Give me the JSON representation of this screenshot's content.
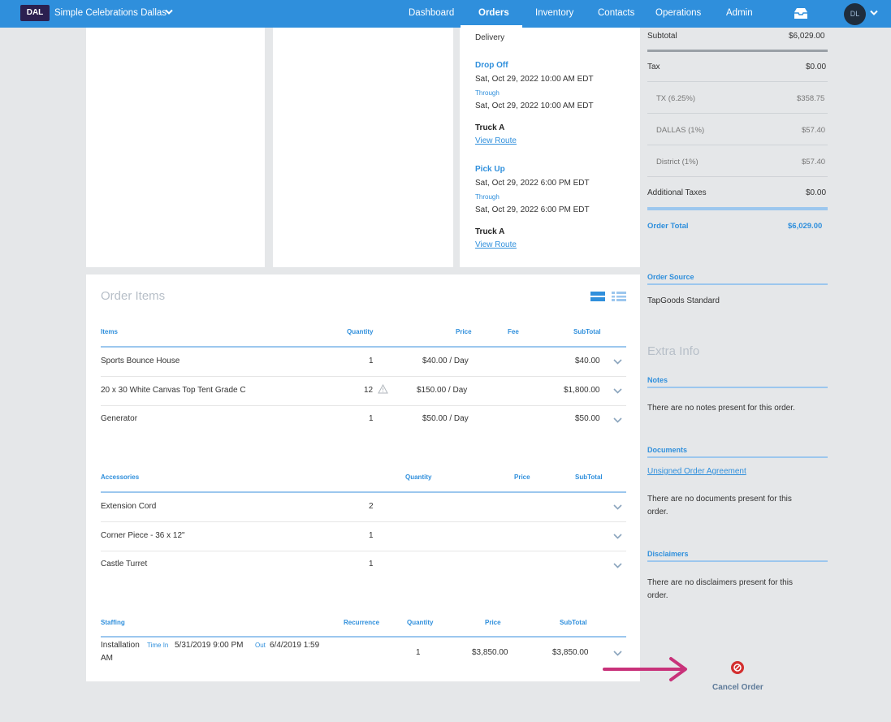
{
  "header": {
    "badge": "DAL",
    "company": "Simple Celebrations Dallas",
    "nav": [
      "Dashboard",
      "Orders",
      "Inventory",
      "Contacts",
      "Operations",
      "Admin"
    ],
    "active_nav": "Orders",
    "avatar_initials": "DL"
  },
  "delivery": {
    "heading": "Delivery",
    "drop_off_label": "Drop Off",
    "drop_off_start": "Sat, Oct 29, 2022 10:00 AM EDT",
    "through_1": "Through",
    "drop_off_end": "Sat, Oct 29, 2022 10:00 AM EDT",
    "truck_1": "Truck A",
    "view_route_1": "View Route",
    "pick_up_label": "Pick Up",
    "pick_up_start": "Sat, Oct 29, 2022 6:00 PM EDT",
    "through_2": "Through",
    "pick_up_end": "Sat, Oct 29, 2022 6:00 PM EDT",
    "truck_2": "Truck A",
    "view_route_2": "View Route"
  },
  "order_items": {
    "title": "Order Items",
    "items_headers": {
      "items": "Items",
      "quantity": "Quantity",
      "price": "Price",
      "fee": "Fee",
      "subtotal": "SubTotal"
    },
    "items": [
      {
        "name": "Sports Bounce House",
        "qty": "1",
        "price": "$40.00 / Day",
        "subtotal": "$40.00"
      },
      {
        "name": "20 x 30 White Canvas Top Tent Grade C",
        "qty": "12",
        "price": "$150.00 / Day",
        "subtotal": "$1,800.00"
      },
      {
        "name": "Generator",
        "qty": "1",
        "price": "$50.00 / Day",
        "subtotal": "$50.00"
      }
    ],
    "accessories_headers": {
      "accessories": "Accessories",
      "quantity": "Quantity",
      "price": "Price",
      "subtotal": "SubTotal"
    },
    "accessories": [
      {
        "name": "Extension Cord",
        "qty": "2"
      },
      {
        "name": "Corner Piece - 36 x 12\"",
        "qty": "1"
      },
      {
        "name": "Castle Turret",
        "qty": "1"
      }
    ],
    "staffing_headers": {
      "staffing": "Staffing",
      "recurrence": "Recurrence",
      "quantity": "Quantity",
      "price": "Price",
      "subtotal": "SubTotal"
    },
    "staffing": {
      "name": "Installation",
      "time_in_label": "Time In",
      "time_in": "5/31/2019 9:00 PM",
      "out_label": "Out",
      "out": "6/4/2019 1:59",
      "out_suffix": "AM",
      "qty": "1",
      "price": "$3,850.00",
      "subtotal": "$3,850.00"
    }
  },
  "summary": {
    "subtotal_label": "Subtotal",
    "subtotal": "$6,029.00",
    "tax_label": "Tax",
    "tax": "$0.00",
    "tx_label": "TX (6.25%)",
    "tx": "$358.75",
    "dallas_label": "DALLAS (1%)",
    "dallas": "$57.40",
    "district_label": "District (1%)",
    "district": "$57.40",
    "additional_label": "Additional Taxes",
    "additional": "$0.00",
    "total_label": "Order Total",
    "total": "$6,029.00",
    "source_label": "Order Source",
    "source": "TapGoods Standard"
  },
  "extra": {
    "title": "Extra Info",
    "notes_label": "Notes",
    "notes_text": "There are no notes present for this order.",
    "documents_label": "Documents",
    "documents_link": "Unsigned Order Agreement",
    "documents_text_1": "There are no documents present for this",
    "documents_text_2": "order.",
    "disclaimers_label": "Disclaimers",
    "disclaimers_text_1": "There are no disclaimers present for this",
    "disclaimers_text_2": "order.",
    "cancel_label": "Cancel Order"
  },
  "colors": {
    "primary": "#2f8fdc",
    "badge": "#2b2050",
    "danger": "#d32f2f",
    "arrow": "#c8327a"
  }
}
